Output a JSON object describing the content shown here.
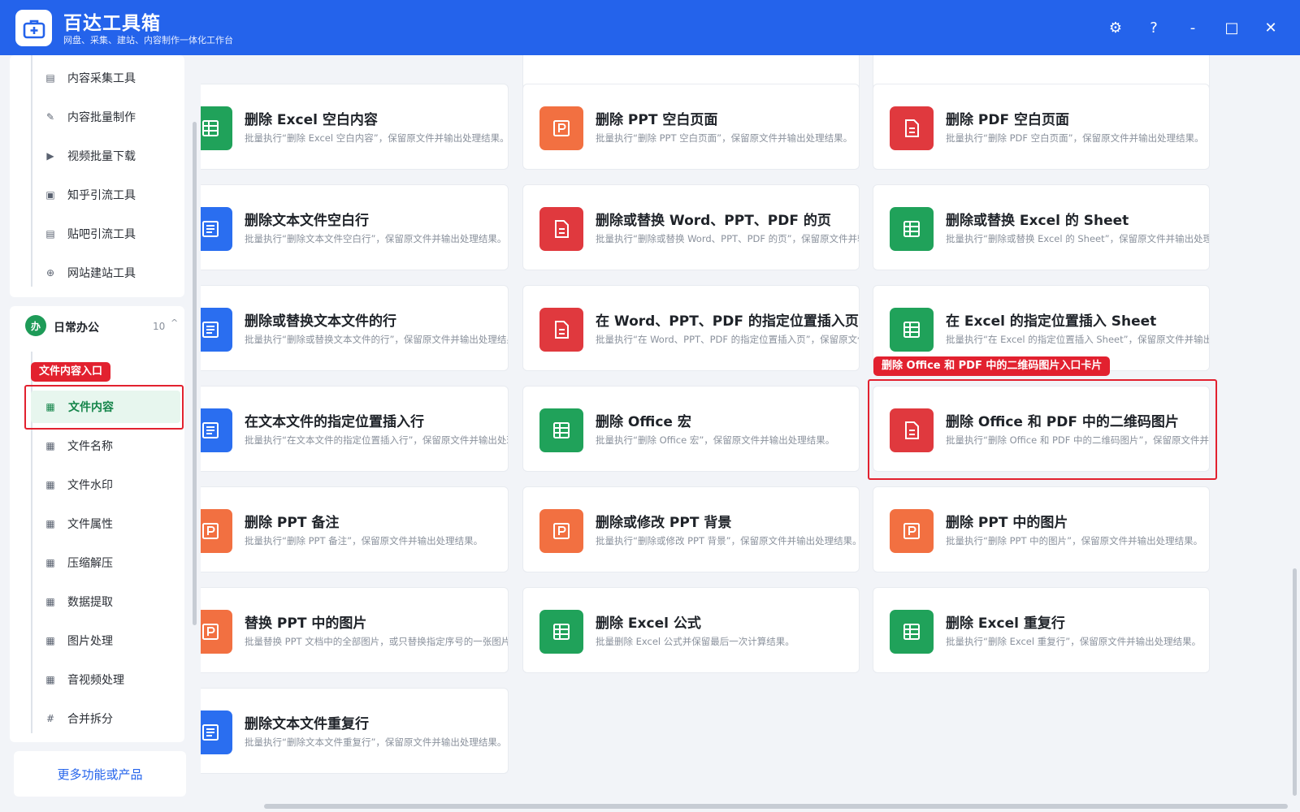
{
  "app": {
    "title": "百达工具箱",
    "subtitle": "网盘、采集、建站、内容制作一体化工作台"
  },
  "window_controls": {
    "settings": "⚙",
    "help": "?",
    "minimize": "-",
    "maximize": "□",
    "close": "✕"
  },
  "sidebar": {
    "top_items": [
      {
        "label": "内容采集工具",
        "icon": "book-icon"
      },
      {
        "label": "内容批量制作",
        "icon": "pen-icon"
      },
      {
        "label": "视频批量下载",
        "icon": "video-icon"
      },
      {
        "label": "知乎引流工具",
        "icon": "zhihu-icon"
      },
      {
        "label": "贴吧引流工具",
        "icon": "tieba-icon"
      },
      {
        "label": "网站建站工具",
        "icon": "globe-icon"
      }
    ],
    "group": {
      "badge": "办",
      "name": "日常办公",
      "count": "10",
      "caret": "^"
    },
    "group_items": [
      {
        "label": "文件内容",
        "icon": "grid-icon",
        "active": true
      },
      {
        "label": "文件名称",
        "icon": "grid-icon"
      },
      {
        "label": "文件水印",
        "icon": "grid-icon"
      },
      {
        "label": "文件属性",
        "icon": "grid-icon"
      },
      {
        "label": "压缩解压",
        "icon": "grid-icon"
      },
      {
        "label": "数据提取",
        "icon": "grid-icon"
      },
      {
        "label": "图片处理",
        "icon": "grid-icon"
      },
      {
        "label": "音视频处理",
        "icon": "grid-icon"
      },
      {
        "label": "合并拆分",
        "icon": "hash-icon"
      }
    ],
    "more_button": "更多功能或产品"
  },
  "annotations": {
    "sidebar_tag": "文件内容入口",
    "card_tag": "删除 Office 和 PDF 中的二维码图片入口卡片"
  },
  "cards": [
    {
      "title": "删除 Excel 空白内容",
      "desc": "批量执行“删除 Excel 空白内容”，保留原文件并输出处理结果。",
      "type": "excel"
    },
    {
      "title": "删除 PPT 空白页面",
      "desc": "批量执行“删除 PPT 空白页面”，保留原文件并输出处理结果。",
      "type": "ppt"
    },
    {
      "title": "删除 PDF 空白页面",
      "desc": "批量执行“删除 PDF 空白页面”，保留原文件并输出处理结果。",
      "type": "pdf"
    },
    {
      "title": "删除文本文件空白行",
      "desc": "批量执行“删除文本文件空白行”，保留原文件并输出处理结果。",
      "type": "text"
    },
    {
      "title": "删除或替换 Word、PPT、PDF 的页",
      "desc": "批量执行“删除或替换 Word、PPT、PDF 的页”，保留原文件并输出处理结果。",
      "type": "pdf"
    },
    {
      "title": "删除或替换 Excel 的 Sheet",
      "desc": "批量执行“删除或替换 Excel 的 Sheet”，保留原文件并输出处理结果。",
      "type": "excel"
    },
    {
      "title": "删除或替换文本文件的行",
      "desc": "批量执行“删除或替换文本文件的行”，保留原文件并输出处理结果。",
      "type": "text"
    },
    {
      "title": "在 Word、PPT、PDF 的指定位置插入页",
      "desc": "批量执行“在 Word、PPT、PDF 的指定位置插入页”，保留原文件并输出处理结果。",
      "type": "pdf"
    },
    {
      "title": "在 Excel 的指定位置插入 Sheet",
      "desc": "批量执行“在 Excel 的指定位置插入 Sheet”，保留原文件并输出处理结果。",
      "type": "excel"
    },
    {
      "title": "在文本文件的指定位置插入行",
      "desc": "批量执行“在文本文件的指定位置插入行”，保留原文件并输出处理结果。",
      "type": "text"
    },
    {
      "title": "删除 Office 宏",
      "desc": "批量执行“删除 Office 宏”，保留原文件并输出处理结果。",
      "type": "excel"
    },
    {
      "title": "删除 Office 和 PDF 中的二维码图片",
      "desc": "批量执行“删除 Office 和 PDF 中的二维码图片”，保留原文件并输出处理结果。",
      "type": "pdf"
    },
    {
      "title": "删除 PPT 备注",
      "desc": "批量执行“删除 PPT 备注”，保留原文件并输出处理结果。",
      "type": "ppt"
    },
    {
      "title": "删除或修改 PPT 背景",
      "desc": "批量执行“删除或修改 PPT 背景”，保留原文件并输出处理结果。",
      "type": "ppt"
    },
    {
      "title": "删除 PPT 中的图片",
      "desc": "批量执行“删除 PPT 中的图片”，保留原文件并输出处理结果。",
      "type": "ppt"
    },
    {
      "title": "替换 PPT 中的图片",
      "desc": "批量替换 PPT 文档中的全部图片，或只替换指定序号的一张图片。",
      "type": "ppt"
    },
    {
      "title": "删除 Excel 公式",
      "desc": "批量删除 Excel 公式并保留最后一次计算结果。",
      "type": "excel"
    },
    {
      "title": "删除 Excel 重复行",
      "desc": "批量执行“删除 Excel 重复行”，保留原文件并输出处理结果。",
      "type": "excel"
    },
    {
      "title": "删除文本文件重复行",
      "desc": "批量执行“删除文本文件重复行”，保留原文件并输出处理结果。",
      "type": "text"
    }
  ]
}
